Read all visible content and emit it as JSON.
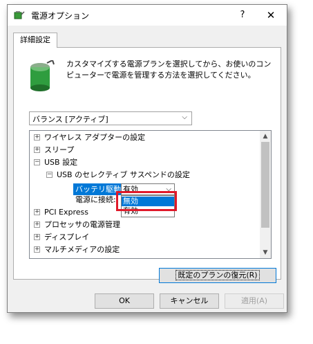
{
  "window": {
    "title": "電源オプション",
    "help": "?",
    "close": "✕"
  },
  "tab": {
    "label": "詳細設定"
  },
  "description": "カスタマイズする電源プランを選択してから、お使いのコンピューターで電源を管理する方法を選択してください。",
  "plan_select": {
    "value": "バランス [アクティブ]"
  },
  "tree": {
    "items": [
      {
        "label": "ワイヤレス アダプターの設定",
        "expander": "+"
      },
      {
        "label": "スリープ",
        "expander": "+"
      },
      {
        "label": "USB 設定",
        "expander": "−"
      },
      {
        "label": "USB のセレクティブ サスペンドの設定",
        "expander": "−"
      },
      {
        "label": "電源に接続:"
      },
      {
        "label": "PCI Express",
        "expander": "+"
      },
      {
        "label": "プロセッサの電源管理",
        "expander": "+"
      },
      {
        "label": "ディスプレイ",
        "expander": "+"
      },
      {
        "label": "マルチメディアの設定",
        "expander": "+"
      }
    ],
    "battery_label": "バッテリ駆動:",
    "battery_value": "有効",
    "dropdown_options": [
      "無効",
      "有効"
    ],
    "selected_option": "無効"
  },
  "buttons": {
    "restore": "既定のプランの復元(R)",
    "ok": "OK",
    "cancel": "キャンセル",
    "apply": "適用(A)"
  },
  "colors": {
    "highlight": "#0078d7",
    "annotation": "#e0192a"
  }
}
